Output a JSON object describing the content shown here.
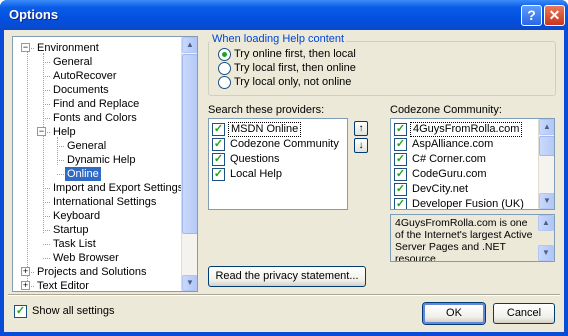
{
  "window": {
    "title": "Options",
    "help_glyph": "?",
    "close_glyph": "✕"
  },
  "tree": {
    "items": [
      {
        "label": "Environment",
        "expander": "−"
      },
      {
        "label": "General"
      },
      {
        "label": "AutoRecover"
      },
      {
        "label": "Documents"
      },
      {
        "label": "Find and Replace"
      },
      {
        "label": "Fonts and Colors"
      },
      {
        "label": "Help",
        "expander": "−"
      },
      {
        "label": "General"
      },
      {
        "label": "Dynamic Help"
      },
      {
        "label": "Online",
        "selected": true
      },
      {
        "label": "Import and Export Settings"
      },
      {
        "label": "International Settings"
      },
      {
        "label": "Keyboard"
      },
      {
        "label": "Startup"
      },
      {
        "label": "Task List"
      },
      {
        "label": "Web Browser"
      },
      {
        "label": "Projects and Solutions",
        "expander": "+"
      },
      {
        "label": "Text Editor",
        "expander": "+"
      }
    ],
    "scroll_up": "▲",
    "scroll_down": "▼"
  },
  "help_content": {
    "group_title": "When loading Help content",
    "options": [
      {
        "label": "Try online first, then local",
        "selected": true
      },
      {
        "label": "Try local first, then online",
        "selected": false
      },
      {
        "label": "Try local only, not online",
        "selected": false
      }
    ]
  },
  "providers": {
    "label": "Search these providers:",
    "items": [
      {
        "label": "MSDN Online",
        "checked": true,
        "focused": true
      },
      {
        "label": "Codezone Community",
        "checked": true
      },
      {
        "label": "Questions",
        "checked": true
      },
      {
        "label": "Local Help",
        "checked": true
      }
    ],
    "move_up": "↑",
    "move_down": "↓"
  },
  "codezone": {
    "label": "Codezone Community:",
    "items": [
      {
        "label": "4GuysFromRolla.com",
        "checked": true,
        "focused": true
      },
      {
        "label": "AspAlliance.com",
        "checked": true
      },
      {
        "label": "C# Corner.com",
        "checked": true
      },
      {
        "label": "CodeGuru.com",
        "checked": true
      },
      {
        "label": "DevCity.net",
        "checked": true
      },
      {
        "label": "Developer Fusion (UK)",
        "checked": true
      }
    ],
    "description": "4GuysFromRolla.com is one of the Internet's largest Active Server Pages and .NET resource"
  },
  "check_glyph": "✓",
  "privacy_button": "Read the privacy statement...",
  "show_all_settings": {
    "label": "Show all settings",
    "checked": true
  },
  "ok_button": "OK",
  "cancel_button": "Cancel"
}
